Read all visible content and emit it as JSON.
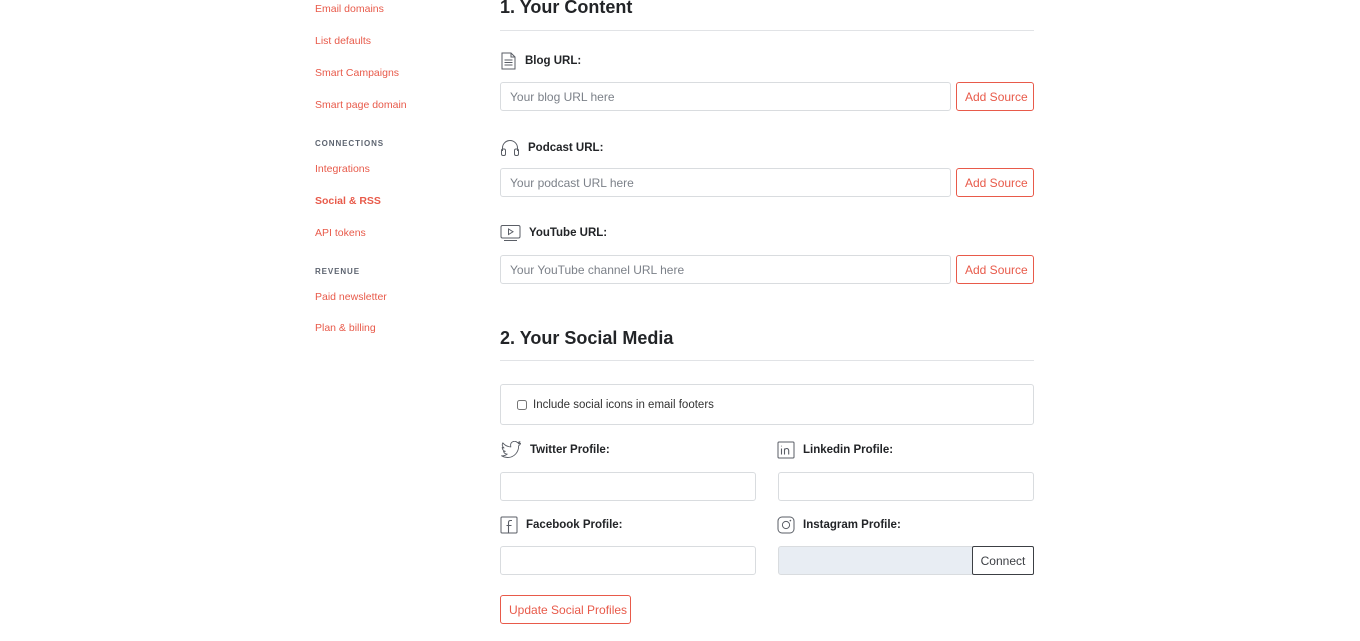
{
  "sidebar": {
    "items": [
      {
        "label": "Email domains"
      },
      {
        "label": "List defaults"
      },
      {
        "label": "Smart Campaigns"
      },
      {
        "label": "Smart page domain"
      }
    ],
    "connections_heading": "CONNECTIONS",
    "connections": [
      {
        "label": "Integrations"
      },
      {
        "label": "Social & RSS"
      },
      {
        "label": "API tokens"
      }
    ],
    "revenue_heading": "REVENUE",
    "revenue": [
      {
        "label": "Paid newsletter"
      },
      {
        "label": "Plan & billing"
      }
    ]
  },
  "content": {
    "title": "1. Your Content",
    "blog": {
      "label": "Blog URL:",
      "placeholder": "Your blog URL here",
      "button": "Add Source"
    },
    "podcast": {
      "label": "Podcast URL:",
      "placeholder": "Your podcast URL here",
      "button": "Add Source"
    },
    "youtube": {
      "label": "YouTube URL:",
      "placeholder": "Your YouTube channel URL here",
      "button": "Add Source"
    }
  },
  "social": {
    "title": "2. Your Social Media",
    "include_icons_label": "Include social icons in email footers",
    "include_icons_checked": false,
    "twitter_label": "Twitter Profile:",
    "linkedin_label": "Linkedin Profile:",
    "facebook_label": "Facebook Profile:",
    "instagram_label": "Instagram Profile:",
    "connect_button": "Connect",
    "update_button": "Update Social Profiles"
  },
  "colors": {
    "accent": "#e85a4a",
    "text": "#222427",
    "border": "#d9dcdf"
  }
}
